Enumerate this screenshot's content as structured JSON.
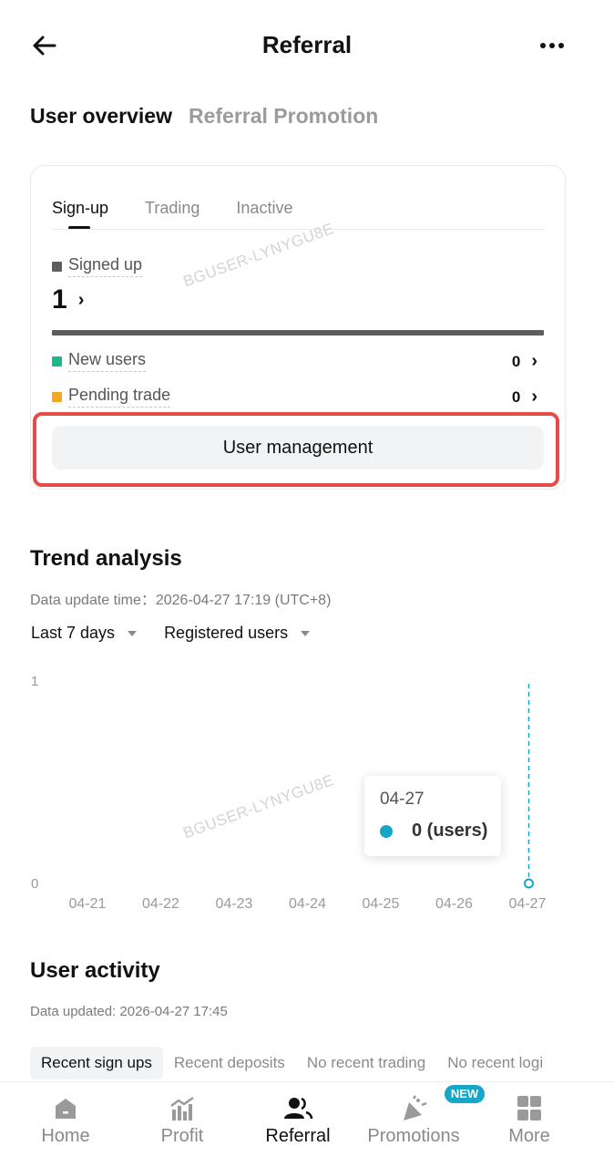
{
  "header": {
    "title": "Referral",
    "back_icon": "arrow-left-icon",
    "more_icon": "more-dots-icon"
  },
  "top_tabs": [
    {
      "label": "User overview",
      "active": true
    },
    {
      "label": "Referral Promotion",
      "active": false
    }
  ],
  "overview": {
    "sub_tabs": [
      {
        "label": "Sign-up",
        "active": true
      },
      {
        "label": "Trading",
        "active": false
      },
      {
        "label": "Inactive",
        "active": false
      }
    ],
    "signed_up_label": "Signed up",
    "signed_up_count": "1",
    "new_users_label": "New users",
    "new_users_count": "0",
    "pending_trade_label": "Pending trade",
    "pending_trade_count": "0",
    "user_management_label": "User management",
    "colors": {
      "signed_up": "#5e5e5e",
      "new_users": "#1bb98a",
      "pending_trade": "#f5a623",
      "highlight": "#e84a4a"
    }
  },
  "watermark": "BGUSER-LYNYGU8E",
  "trend": {
    "title": "Trend analysis",
    "update_time": "Data update time：2026-04-27 17:19 (UTC+8)",
    "filter_period": "Last 7 days",
    "filter_metric": "Registered users",
    "tooltip_date": "04-27",
    "tooltip_value": "0 (users)"
  },
  "chart_data": {
    "type": "line",
    "x": [
      "04-21",
      "04-22",
      "04-23",
      "04-24",
      "04-25",
      "04-26",
      "04-27"
    ],
    "series": [
      {
        "values": [
          0,
          0,
          0,
          0,
          0,
          0,
          0
        ],
        "color": "#16a6c6"
      }
    ],
    "y_ticks": [
      "0",
      "1"
    ],
    "ylim": [
      0,
      1
    ],
    "highlighted_x": "04-27",
    "grid": false
  },
  "activity": {
    "title": "User activity",
    "update_time": "Data updated: 2026-04-27 17:45",
    "tabs": [
      "Recent sign ups",
      "Recent deposits",
      "No recent trading",
      "No recent logi"
    ]
  },
  "bottom_nav": [
    {
      "label": "Home",
      "icon": "home-icon",
      "active": false
    },
    {
      "label": "Profit",
      "icon": "profit-chart-icon",
      "active": false
    },
    {
      "label": "Referral",
      "icon": "users-icon",
      "active": true
    },
    {
      "label": "Promotions",
      "icon": "party-popper-icon",
      "active": false,
      "badge": "NEW"
    },
    {
      "label": "More",
      "icon": "grid-icon",
      "active": false
    }
  ]
}
